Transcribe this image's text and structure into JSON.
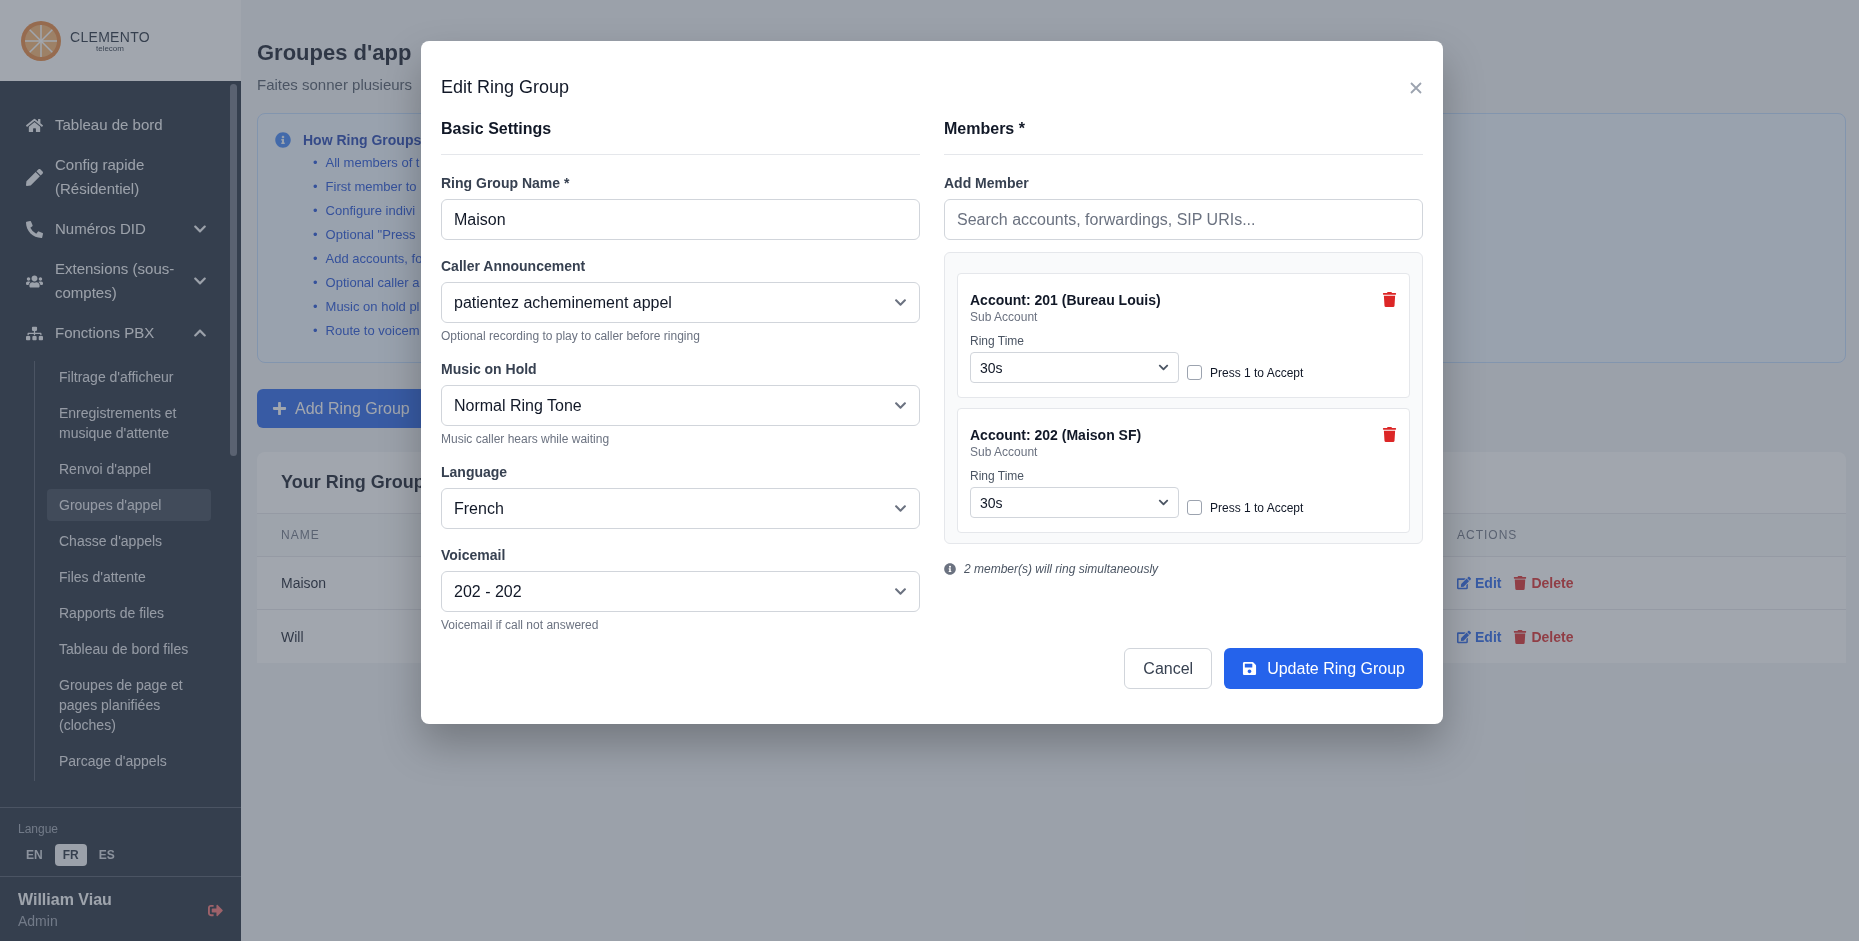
{
  "brand": {
    "name": "CLEMENTO",
    "tagline": "telecom"
  },
  "nav": [
    {
      "kind": "link",
      "label": "Tableau de bord"
    },
    {
      "kind": "link",
      "label": "Config rapide (Résidentiel)"
    },
    {
      "kind": "group",
      "label": "Numéros DID",
      "expanded": false
    },
    {
      "kind": "group",
      "label": "Extensions (sous-comptes)",
      "expanded": false
    },
    {
      "kind": "group",
      "label": "Fonctions PBX",
      "expanded": true,
      "children": [
        {
          "label": "Filtrage d'afficheur",
          "selected": false
        },
        {
          "label": "Enregistrements et musique d'attente",
          "selected": false
        },
        {
          "label": "Renvoi d'appel",
          "selected": false
        },
        {
          "label": "Groupes d'appel",
          "selected": true
        },
        {
          "label": "Chasse d'appels",
          "selected": false
        },
        {
          "label": "Files d'attente",
          "selected": false
        },
        {
          "label": "Rapports de files",
          "selected": false
        },
        {
          "label": "Tableau de bord files",
          "selected": false
        },
        {
          "label": "Groupes de page et pages planifiées (cloches)",
          "selected": false
        },
        {
          "label": "Parcage d'appels",
          "selected": false
        }
      ]
    }
  ],
  "language": {
    "label": "Langue",
    "options": [
      {
        "label": "EN",
        "selected": false
      },
      {
        "label": "FR",
        "selected": true
      },
      {
        "label": "ES",
        "selected": false
      }
    ]
  },
  "user": {
    "name": "William Viau",
    "role": "Admin"
  },
  "page": {
    "title": "Groupes d'app",
    "subtitle": "Faites sonner plusieurs",
    "info": {
      "title": "How Ring Groups",
      "bullet": "•",
      "items": [
        "All members of t",
        "First member to",
        "Configure indivi",
        "Optional \"Press",
        "Add accounts, fo",
        "Optional caller a",
        "Music on hold pl",
        "Route to voicem"
      ]
    },
    "add_button": "Add Ring Group",
    "table": {
      "title": "Your Ring Group",
      "columns": [
        "NAME",
        "ACTIONS"
      ],
      "rows": [
        {
          "name": "Maison",
          "actions": [
            {
              "kind": "edit",
              "label": "Edit"
            },
            {
              "kind": "delete",
              "label": "Delete"
            }
          ]
        },
        {
          "name": "Will",
          "actions": [
            {
              "kind": "edit",
              "label": "Edit"
            },
            {
              "kind": "delete",
              "label": "Delete"
            }
          ]
        }
      ]
    }
  },
  "modal": {
    "title": "Edit Ring Group",
    "basic": {
      "heading": "Basic Settings",
      "fields": [
        {
          "kind": "text",
          "label": "Ring Group Name *",
          "value": "Maison"
        },
        {
          "kind": "select",
          "label": "Caller Announcement",
          "value": "patientez acheminement appel",
          "help": "Optional recording to play to caller before ringing"
        },
        {
          "kind": "select",
          "label": "Music on Hold",
          "value": "Normal Ring Tone",
          "help": "Music caller hears while waiting"
        },
        {
          "kind": "select",
          "label": "Language",
          "value": "French"
        },
        {
          "kind": "select",
          "label": "Voicemail",
          "value": "202 - 202",
          "help": "Voicemail if call not answered"
        }
      ]
    },
    "members": {
      "heading": "Members *",
      "add_label": "Add Member",
      "search_placeholder": "Search accounts, forwardings, SIP URIs...",
      "list": [
        {
          "name": "Account: 201 (Bureau Louis)",
          "type": "Sub Account",
          "ring_time_label": "Ring Time",
          "ring_time": "30s",
          "press1": {
            "label": "Press 1 to Accept",
            "checked": false
          }
        },
        {
          "name": "Account: 202 (Maison SF)",
          "type": "Sub Account",
          "ring_time_label": "Ring Time",
          "ring_time": "30s",
          "press1": {
            "label": "Press 1 to Accept",
            "checked": false
          }
        }
      ],
      "note": "2 member(s) will ring simultaneously"
    },
    "buttons": [
      {
        "kind": "secondary",
        "label": "Cancel"
      },
      {
        "kind": "primary",
        "label": "Update Ring Group"
      }
    ]
  }
}
